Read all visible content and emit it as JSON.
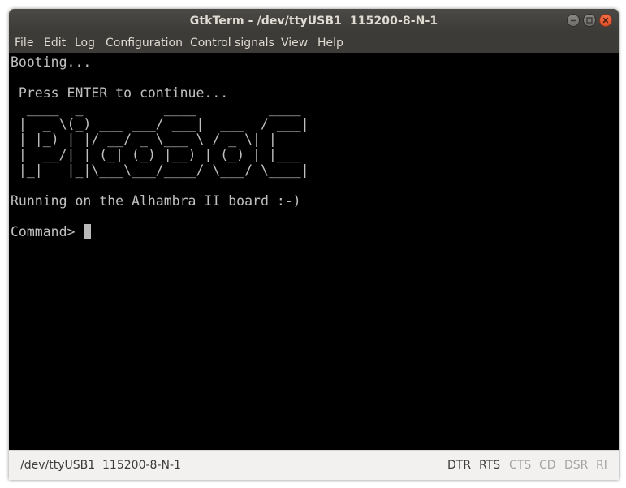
{
  "window": {
    "title": "GtkTerm - /dev/ttyUSB1  115200-8-N-1"
  },
  "menu": {
    "items": [
      "File",
      "Edit",
      "Log",
      "Configuration",
      "Control signals",
      "View",
      "Help"
    ]
  },
  "terminal": {
    "lines": [
      "Booting...",
      "",
      " Press ENTER to continue...",
      "  ____  _          ____         ____",
      " |  _ \\(_) ___ ___/ ___|  ___  / ___|",
      " | |_) | |/ __/ _ \\___ \\ / _ \\| |",
      " |  __/| | (_| (_) |__) | (_) | |___",
      " |_|   |_|\\___\\___/____/ \\___/ \\____|",
      "",
      "Running on the Alhambra II board :-)",
      "",
      "Command> "
    ]
  },
  "status": {
    "port": "/dev/ttyUSB1  115200-8-N-1",
    "signals": [
      {
        "label": "DTR",
        "active": true
      },
      {
        "label": "RTS",
        "active": true
      },
      {
        "label": "CTS",
        "active": false
      },
      {
        "label": "CD",
        "active": false
      },
      {
        "label": "DSR",
        "active": false
      },
      {
        "label": "RI",
        "active": false
      }
    ]
  },
  "colors": {
    "terminal_bg": "#000000",
    "terminal_fg": "#c0c0c0",
    "titlebar": "#3c3b37",
    "close_button": "#e95420"
  }
}
